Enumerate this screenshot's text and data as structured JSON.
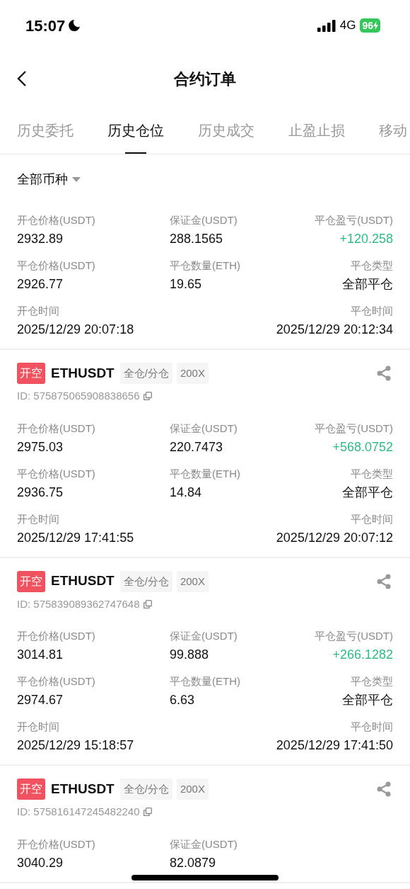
{
  "status_bar": {
    "time": "15:07",
    "network": "4G",
    "battery": "96"
  },
  "header": {
    "title": "合约订单"
  },
  "tabs": [
    {
      "label": "历史委托",
      "selected": false
    },
    {
      "label": "历史仓位",
      "selected": true
    },
    {
      "label": "历史成交",
      "selected": false
    },
    {
      "label": "止盈止损",
      "selected": false
    },
    {
      "label": "移动",
      "selected": false
    }
  ],
  "filter": {
    "label": "全部币种"
  },
  "orders": [
    {
      "rows": [
        [
          {
            "label": "开仓价格(USDT)",
            "value": "2932.89",
            "kind": "plain"
          },
          {
            "label": "保证金(USDT)",
            "value": "288.1565",
            "kind": "plain"
          },
          {
            "label": "平仓盈亏(USDT)",
            "value": "+120.258",
            "kind": "profit"
          }
        ],
        [
          {
            "label": "平仓价格(USDT)",
            "value": "2926.77",
            "kind": "plain"
          },
          {
            "label": "平仓数量(ETH)",
            "value": "19.65",
            "kind": "plain"
          },
          {
            "label": "平仓类型",
            "value": "全部平仓",
            "kind": "plain"
          }
        ],
        [
          {
            "label": "开仓时间",
            "value": "2025/12/29 20:07:18",
            "kind": "plain"
          },
          null,
          {
            "label": "平仓时间",
            "value": "2025/12/29 20:12:34",
            "kind": "plain"
          }
        ]
      ]
    },
    {
      "side": "开空",
      "symbol": "ETHUSDT",
      "margin_mode": "全仓/分仓",
      "leverage": "200X",
      "id": "ID: 575875065908838656",
      "rows": [
        [
          {
            "label": "开仓价格(USDT)",
            "value": "2975.03",
            "kind": "plain"
          },
          {
            "label": "保证金(USDT)",
            "value": "220.7473",
            "kind": "plain"
          },
          {
            "label": "平仓盈亏(USDT)",
            "value": "+568.0752",
            "kind": "profit"
          }
        ],
        [
          {
            "label": "平仓价格(USDT)",
            "value": "2936.75",
            "kind": "plain"
          },
          {
            "label": "平仓数量(ETH)",
            "value": "14.84",
            "kind": "plain"
          },
          {
            "label": "平仓类型",
            "value": "全部平仓",
            "kind": "plain"
          }
        ],
        [
          {
            "label": "开仓时间",
            "value": "2025/12/29 17:41:55",
            "kind": "plain"
          },
          null,
          {
            "label": "平仓时间",
            "value": "2025/12/29 20:07:12",
            "kind": "plain"
          }
        ]
      ]
    },
    {
      "side": "开空",
      "symbol": "ETHUSDT",
      "margin_mode": "全仓/分仓",
      "leverage": "200X",
      "id": "ID: 575839089362747648",
      "rows": [
        [
          {
            "label": "开仓价格(USDT)",
            "value": "3014.81",
            "kind": "plain"
          },
          {
            "label": "保证金(USDT)",
            "value": "99.888",
            "kind": "plain"
          },
          {
            "label": "平仓盈亏(USDT)",
            "value": "+266.1282",
            "kind": "profit"
          }
        ],
        [
          {
            "label": "平仓价格(USDT)",
            "value": "2974.67",
            "kind": "plain"
          },
          {
            "label": "平仓数量(ETH)",
            "value": "6.63",
            "kind": "plain"
          },
          {
            "label": "平仓类型",
            "value": "全部平仓",
            "kind": "plain"
          }
        ],
        [
          {
            "label": "开仓时间",
            "value": "2025/12/29 15:18:57",
            "kind": "plain"
          },
          null,
          {
            "label": "平仓时间",
            "value": "2025/12/29 17:41:50",
            "kind": "plain"
          }
        ]
      ]
    },
    {
      "side": "开空",
      "symbol": "ETHUSDT",
      "margin_mode": "全仓/分仓",
      "leverage": "200X",
      "id": "ID: 575816147245482240",
      "rows": [
        [
          {
            "label": "开仓价格(USDT)",
            "value": "3040.29",
            "kind": "plain"
          },
          {
            "label": "保证金(USDT)",
            "value": "82.0879",
            "kind": "plain"
          }
        ]
      ]
    }
  ]
}
